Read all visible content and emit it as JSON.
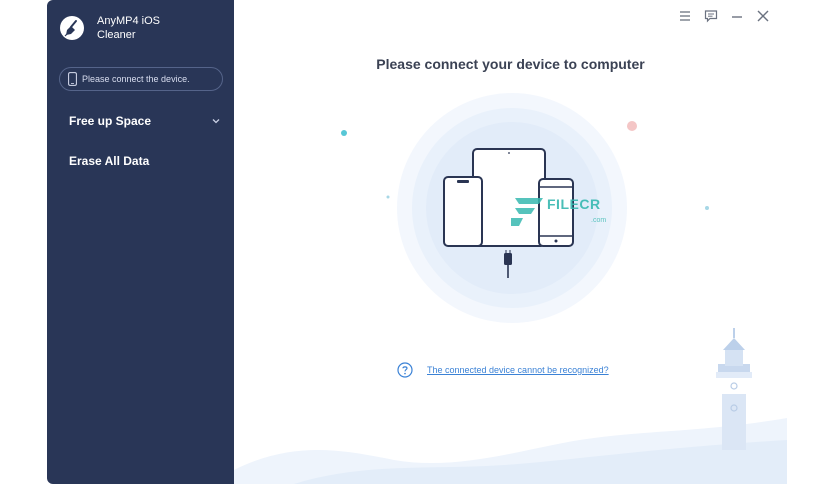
{
  "app": {
    "name": "AnyMP4 iOS Cleaner"
  },
  "sidebar": {
    "device_status": "Please connect the device.",
    "items": [
      {
        "label": "Free up Space",
        "icon": "chevron-down-icon"
      },
      {
        "label": "Erase All Data"
      }
    ]
  },
  "titlebar": {
    "buttons": [
      "menu-icon",
      "feedback-icon",
      "minimize-icon",
      "close-icon"
    ]
  },
  "main": {
    "title": "Please connect your device to computer",
    "help_link": "The connected device cannot be recognized?"
  },
  "watermark": {
    "text": "FILECR",
    "sub": ".com"
  },
  "colors": {
    "sidebar_bg": "#293657",
    "title_text": "#3b4254",
    "link": "#3b82d6",
    "accent_light": "#eaf1fb"
  }
}
